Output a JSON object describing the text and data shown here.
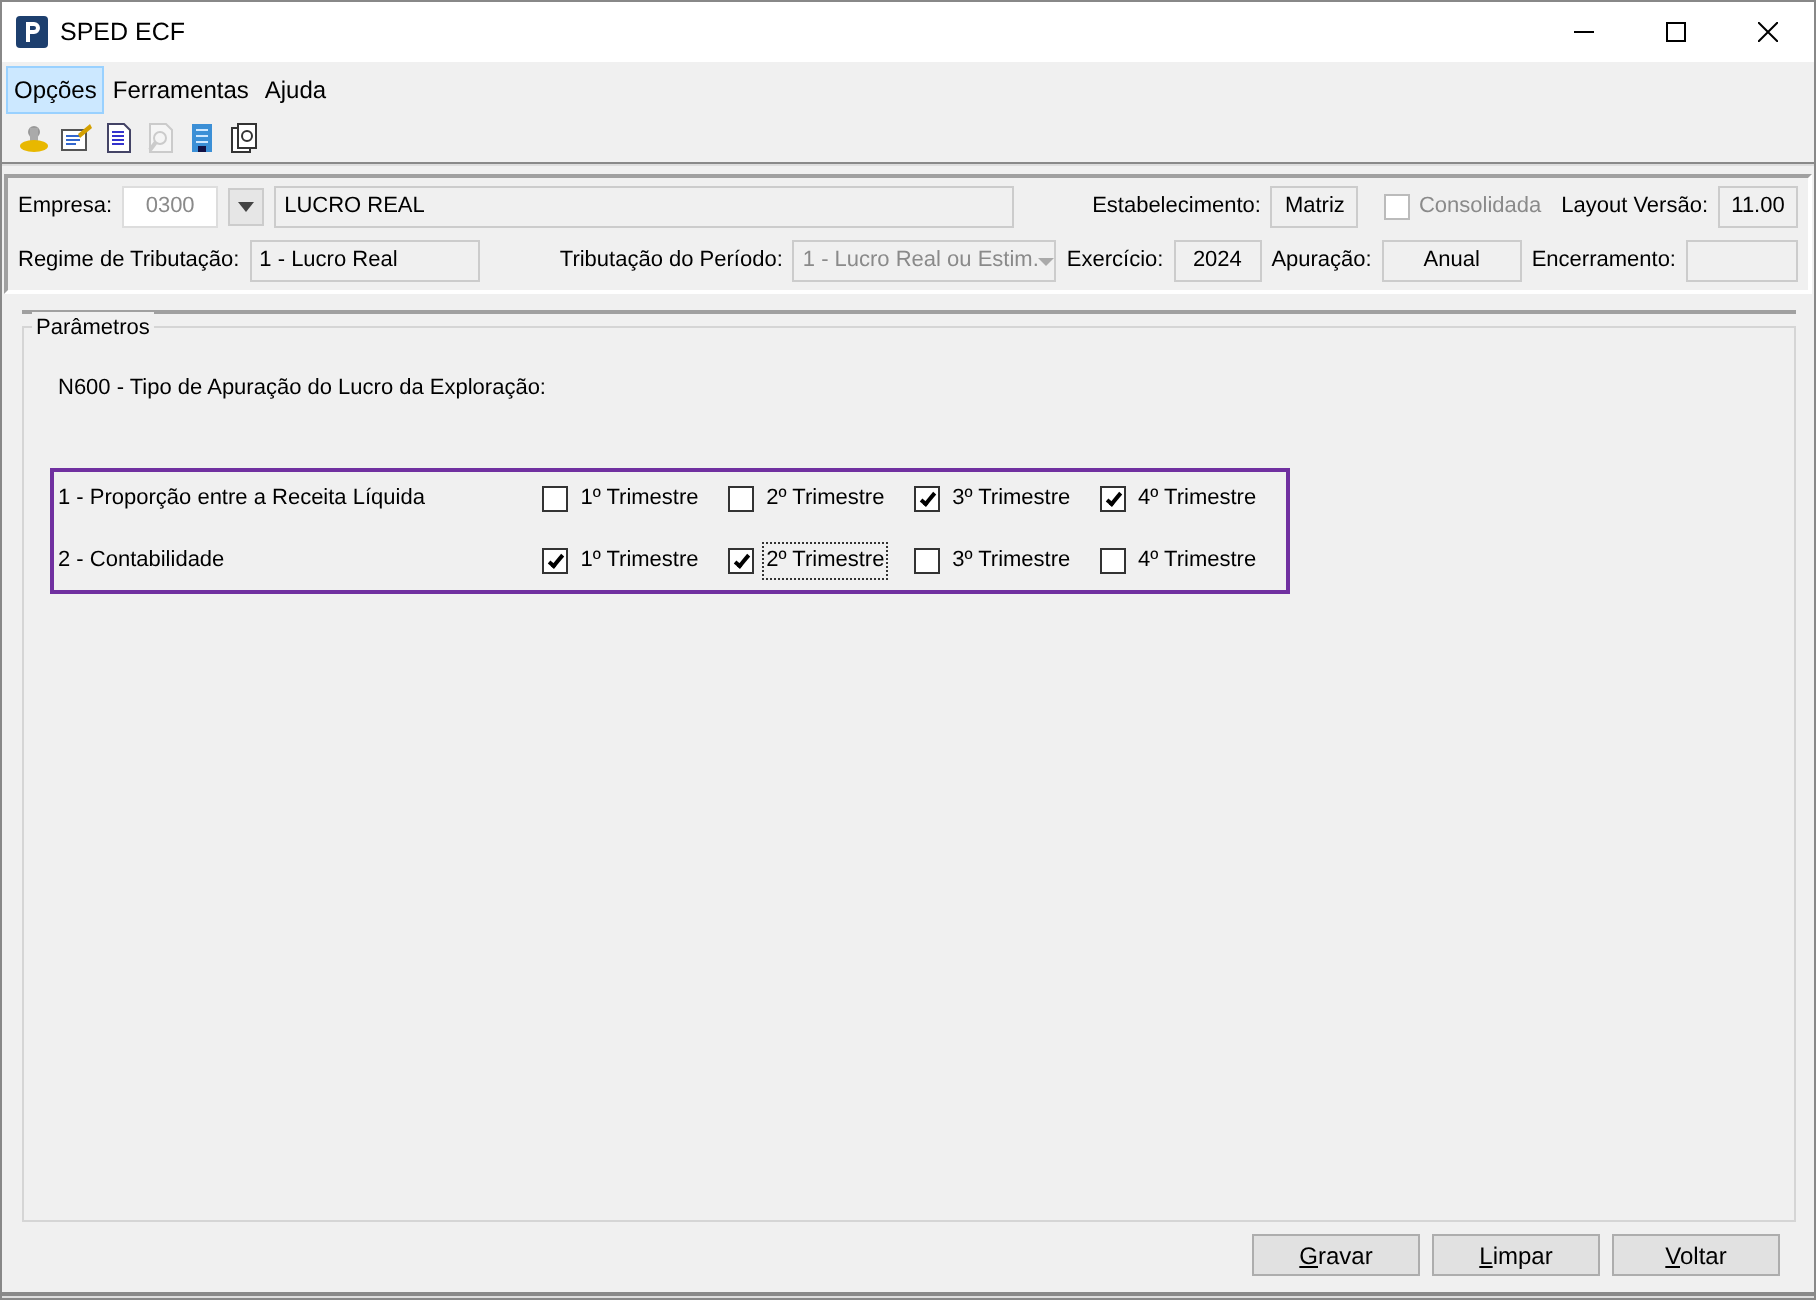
{
  "window": {
    "title": "SPED ECF"
  },
  "menu": [
    {
      "label": "Opções",
      "selected": true
    },
    {
      "label": "Ferramentas",
      "selected": false
    },
    {
      "label": "Ajuda",
      "selected": false
    }
  ],
  "toolbar": [
    {
      "kind": "user",
      "disabled": false
    },
    {
      "kind": "edit",
      "disabled": false
    },
    {
      "kind": "document",
      "disabled": false
    },
    {
      "kind": "search",
      "disabled": true
    },
    {
      "kind": "building",
      "disabled": false
    },
    {
      "kind": "copy",
      "disabled": false
    }
  ],
  "header": {
    "rows": [
      {
        "items": [
          {
            "kind": "label",
            "text": "Empresa:"
          },
          {
            "kind": "input",
            "value": "0300",
            "disabled": true
          },
          {
            "kind": "dropdown_button"
          },
          {
            "kind": "readonly",
            "value": "LUCRO REAL"
          },
          {
            "kind": "label",
            "text": "Estabelecimento:"
          },
          {
            "kind": "readonly",
            "value": "Matriz"
          },
          {
            "kind": "checkbox",
            "text": "Consolidada",
            "checked": false,
            "disabled": true
          },
          {
            "kind": "label",
            "text": "Layout Versão:"
          },
          {
            "kind": "readonly",
            "value": "11.00"
          }
        ]
      },
      {
        "items": [
          {
            "kind": "label",
            "text": "Regime de Tributação:"
          },
          {
            "kind": "readonly",
            "value": "1 - Lucro Real"
          },
          {
            "kind": "label",
            "text": "Tributação do Período:"
          },
          {
            "kind": "combo",
            "value": "1 - Lucro Real ou Estim.",
            "disabled": true
          },
          {
            "kind": "label",
            "text": "Exercício:"
          },
          {
            "kind": "readonly",
            "value": "2024"
          },
          {
            "kind": "label",
            "text": "Apuração:"
          },
          {
            "kind": "readonly",
            "value": "Anual"
          },
          {
            "kind": "label",
            "text": "Encerramento:"
          },
          {
            "kind": "readonly"
          }
        ]
      }
    ]
  },
  "parameters": {
    "legend": "Parâmetros",
    "heading": "N600 - Tipo de Apuração do Lucro da Exploração:",
    "rows": [
      {
        "label": "1 - Proporção entre a Receita Líquida",
        "options": [
          {
            "text": "1º Trimestre",
            "checked": false,
            "focused": false
          },
          {
            "text": "2º Trimestre",
            "checked": false,
            "focused": false
          },
          {
            "text": "3º Trimestre",
            "checked": true,
            "focused": false
          },
          {
            "text": "4º Trimestre",
            "checked": true,
            "focused": false
          }
        ]
      },
      {
        "label": "2 - Contabilidade",
        "options": [
          {
            "text": "1º Trimestre",
            "checked": true,
            "focused": false
          },
          {
            "text": "2º Trimestre",
            "checked": true,
            "focused": true
          },
          {
            "text": "3º Trimestre",
            "checked": false,
            "focused": false
          },
          {
            "text": "4º Trimestre",
            "checked": false,
            "focused": false
          }
        ]
      }
    ]
  },
  "buttons": [
    {
      "label": "Gravar",
      "mnemonic": true
    },
    {
      "label": "Limpar",
      "mnemonic": true
    },
    {
      "label": "Voltar",
      "mnemonic": true
    }
  ]
}
